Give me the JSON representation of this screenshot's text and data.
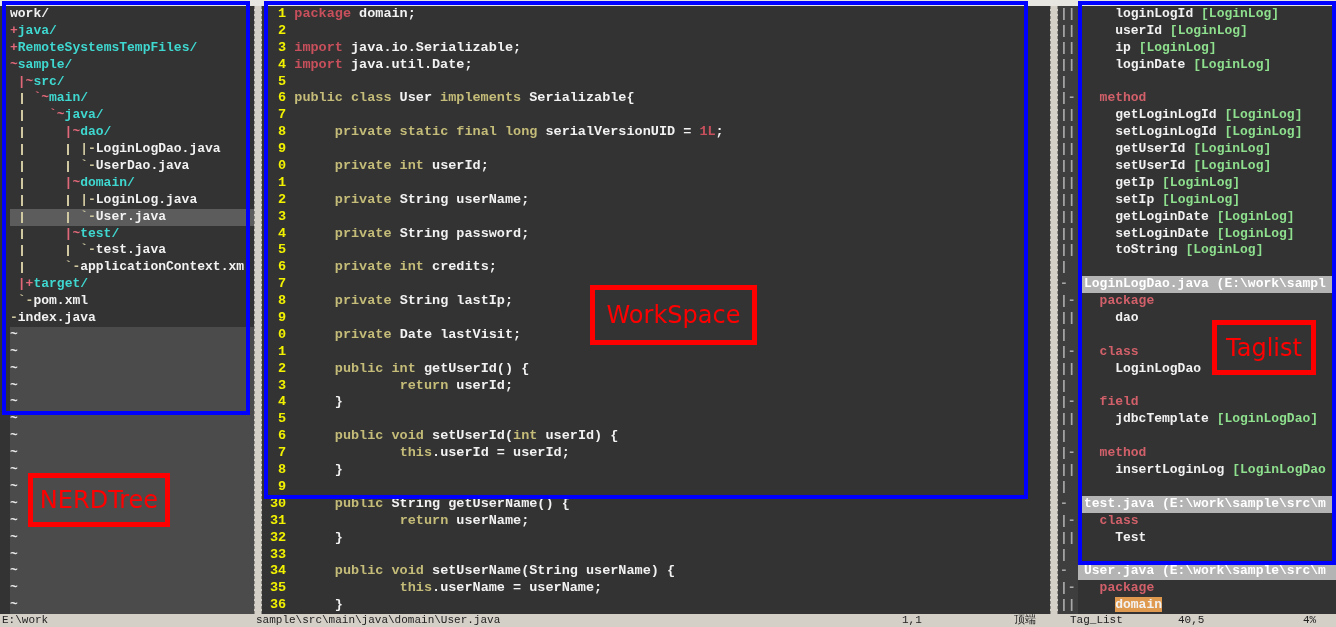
{
  "nerdtree": {
    "root": "work/",
    "nodes": [
      {
        "prefix": "+",
        "name": "java/",
        "kind": "dir",
        "selected": false
      },
      {
        "prefix": "+",
        "name": "RemoteSystemsTempFiles/",
        "kind": "dir",
        "selected": false
      },
      {
        "prefix": "~",
        "name": "sample/",
        "kind": "dir",
        "selected": false,
        "children": [
          {
            "prefix": "|~",
            "name": "src/",
            "kind": "dir",
            "selected": false,
            "children": [
              {
                "prefix": "`~",
                "name": "main/",
                "kind": "dir",
                "selected": false,
                "children": [
                  {
                    "prefix": "`~",
                    "name": "java/",
                    "kind": "dir",
                    "selected": false,
                    "children": [
                      {
                        "prefix": "|~",
                        "name": "dao/",
                        "kind": "dir",
                        "selected": false,
                        "children": [
                          {
                            "prefix": "|-",
                            "name": "LoginLogDao.java",
                            "kind": "file",
                            "selected": false
                          },
                          {
                            "prefix": "`-",
                            "name": "UserDao.java",
                            "kind": "file",
                            "selected": false
                          }
                        ]
                      },
                      {
                        "prefix": "|~",
                        "name": "domain/",
                        "kind": "dir",
                        "selected": false,
                        "children": [
                          {
                            "prefix": "|-",
                            "name": "LoginLog.java",
                            "kind": "file",
                            "selected": false
                          },
                          {
                            "prefix": "`-",
                            "name": "User.java",
                            "kind": "file",
                            "selected": true
                          }
                        ]
                      },
                      {
                        "prefix": "|~",
                        "name": "test/",
                        "kind": "dir",
                        "selected": false,
                        "children": [
                          {
                            "prefix": "`-",
                            "name": "test.java",
                            "kind": "file",
                            "selected": false
                          }
                        ]
                      },
                      {
                        "prefix": "`-",
                        "name": "applicationContext.xm",
                        "kind": "file",
                        "selected": false
                      }
                    ]
                  }
                ]
              }
            ]
          },
          {
            "prefix": "|+",
            "name": "target/",
            "kind": "dir",
            "selected": false
          },
          {
            "prefix": "`-",
            "name": "pom.xml",
            "kind": "file",
            "selected": false
          }
        ]
      },
      {
        "prefix": "-",
        "name": "index.java",
        "kind": "file",
        "selected": false
      }
    ],
    "tildes": [
      "~",
      "~",
      "~",
      "~",
      "~",
      "~",
      "~",
      "~",
      "~",
      "~",
      "~",
      "~",
      "~",
      "~",
      "~",
      "~",
      "~"
    ]
  },
  "editor": {
    "lines": [
      {
        "n": "1",
        "code": [
          {
            "text": "package",
            "kind": "r"
          },
          {
            "text": " domain;",
            "kind": "p"
          }
        ]
      },
      {
        "n": "2"
      },
      {
        "n": "3",
        "code": [
          {
            "text": "import",
            "kind": "r"
          },
          {
            "text": " java.io.Serializable;",
            "kind": "p"
          }
        ]
      },
      {
        "n": "4",
        "code": [
          {
            "text": "import",
            "kind": "r"
          },
          {
            "text": " java.util.Date;",
            "kind": "p"
          }
        ]
      },
      {
        "n": "5"
      },
      {
        "n": "6",
        "code": [
          {
            "text": "public class",
            "kind": "k"
          },
          {
            "text": " User ",
            "kind": "p"
          },
          {
            "text": "implements",
            "kind": "k"
          },
          {
            "text": " Serializable{",
            "kind": "p"
          }
        ]
      },
      {
        "n": "7"
      },
      {
        "n": "8",
        "code": [
          {
            "text": "\tprivate static final long",
            "kind": "k"
          },
          {
            "text": " serialVersionUID = ",
            "kind": "p"
          },
          {
            "text": "1L",
            "kind": "r"
          },
          {
            "text": ";",
            "kind": "p"
          }
        ]
      },
      {
        "n": "9"
      },
      {
        "n": "0",
        "code": [
          {
            "text": "\tprivate int",
            "kind": "k"
          },
          {
            "text": " userId;",
            "kind": "p"
          }
        ]
      },
      {
        "n": "1"
      },
      {
        "n": "2",
        "code": [
          {
            "text": "\tprivate",
            "kind": "k"
          },
          {
            "text": " String userName;",
            "kind": "p"
          }
        ]
      },
      {
        "n": "3"
      },
      {
        "n": "4",
        "code": [
          {
            "text": "\tprivate",
            "kind": "k"
          },
          {
            "text": " String password;",
            "kind": "p"
          }
        ]
      },
      {
        "n": "5"
      },
      {
        "n": "6",
        "code": [
          {
            "text": "\tprivate int",
            "kind": "k"
          },
          {
            "text": " credits;",
            "kind": "p"
          }
        ]
      },
      {
        "n": "7"
      },
      {
        "n": "8",
        "code": [
          {
            "text": "\tprivate",
            "kind": "k"
          },
          {
            "text": " String lastIp;",
            "kind": "p"
          }
        ]
      },
      {
        "n": "9"
      },
      {
        "n": "0",
        "code": [
          {
            "text": "\tprivate",
            "kind": "k"
          },
          {
            "text": " Date lastVisit;",
            "kind": "p"
          }
        ]
      },
      {
        "n": "1"
      },
      {
        "n": "2",
        "code": [
          {
            "text": "\tpublic int",
            "kind": "k"
          },
          {
            "text": " getUserId() {",
            "kind": "p"
          }
        ]
      },
      {
        "n": "3",
        "code": [
          {
            "text": "\t\treturn",
            "kind": "k"
          },
          {
            "text": " userId;",
            "kind": "p"
          }
        ]
      },
      {
        "n": "4",
        "code": [
          {
            "text": "\t}",
            "kind": "p"
          }
        ]
      },
      {
        "n": "5"
      },
      {
        "n": "6",
        "code": [
          {
            "text": "\tpublic void",
            "kind": "k"
          },
          {
            "text": " setUserId(",
            "kind": "p"
          },
          {
            "text": "int",
            "kind": "k"
          },
          {
            "text": " userId) {",
            "kind": "p"
          }
        ]
      },
      {
        "n": "7",
        "code": [
          {
            "text": "\t\tthis",
            "kind": "k"
          },
          {
            "text": ".userId = userId;",
            "kind": "p"
          }
        ]
      },
      {
        "n": "8",
        "code": [
          {
            "text": "\t}",
            "kind": "p"
          }
        ]
      },
      {
        "n": "9"
      },
      {
        "n": "30",
        "code": [
          {
            "text": "\tpublic",
            "kind": "k"
          },
          {
            "text": " String getUserName() {",
            "kind": "p"
          }
        ]
      },
      {
        "n": "31",
        "code": [
          {
            "text": "\t\treturn",
            "kind": "k"
          },
          {
            "text": " userName;",
            "kind": "p"
          }
        ]
      },
      {
        "n": "32",
        "code": [
          {
            "text": "\t}",
            "kind": "p"
          }
        ]
      },
      {
        "n": "33"
      },
      {
        "n": "34",
        "code": [
          {
            "text": "\tpublic void",
            "kind": "k"
          },
          {
            "text": " setUserName(String userName) {",
            "kind": "p"
          }
        ]
      },
      {
        "n": "35",
        "code": [
          {
            "text": "\t\tthis",
            "kind": "k"
          },
          {
            "text": ".userName = userName;",
            "kind": "p"
          }
        ]
      },
      {
        "n": "36",
        "code": [
          {
            "text": "\t}",
            "kind": "p"
          }
        ]
      }
    ]
  },
  "taglist": {
    "rows": [
      {
        "fold": "||",
        "kind": "tag",
        "name": "loginLogId",
        "scope": "[LoginLog]",
        "selected": false
      },
      {
        "fold": "||",
        "kind": "tag",
        "name": "userId",
        "scope": "[LoginLog]",
        "selected": false
      },
      {
        "fold": "||",
        "kind": "tag",
        "name": "ip",
        "scope": "[LoginLog]",
        "selected": false
      },
      {
        "fold": "||",
        "kind": "tag",
        "name": "loginDate",
        "scope": "[LoginLog]",
        "selected": false
      },
      {
        "fold": "|",
        "kind": "blank"
      },
      {
        "fold": "|-",
        "kind": "group",
        "name": "method"
      },
      {
        "fold": "||",
        "kind": "tag",
        "name": "getLoginLogId",
        "scope": "[LoginLog]",
        "selected": false
      },
      {
        "fold": "||",
        "kind": "tag",
        "name": "setLoginLogId",
        "scope": "[LoginLog]",
        "selected": false
      },
      {
        "fold": "||",
        "kind": "tag",
        "name": "getUserId",
        "scope": "[LoginLog]",
        "selected": false
      },
      {
        "fold": "||",
        "kind": "tag",
        "name": "setUserId",
        "scope": "[LoginLog]",
        "selected": false
      },
      {
        "fold": "||",
        "kind": "tag",
        "name": "getIp",
        "scope": "[LoginLog]",
        "selected": false
      },
      {
        "fold": "||",
        "kind": "tag",
        "name": "setIp",
        "scope": "[LoginLog]",
        "selected": false
      },
      {
        "fold": "||",
        "kind": "tag",
        "name": "getLoginDate",
        "scope": "[LoginLog]",
        "selected": false
      },
      {
        "fold": "||",
        "kind": "tag",
        "name": "setLoginDate",
        "scope": "[LoginLog]",
        "selected": false
      },
      {
        "fold": "||",
        "kind": "tag",
        "name": "toString",
        "scope": "[LoginLog]",
        "selected": false
      },
      {
        "fold": "|",
        "kind": "blank"
      },
      {
        "fold": "-",
        "kind": "file",
        "name": "LoginLogDao.java (E:\\work\\sampl"
      },
      {
        "fold": "|-",
        "kind": "group",
        "name": "package"
      },
      {
        "fold": "||",
        "kind": "tag",
        "name": "dao",
        "selected": false
      },
      {
        "fold": "|",
        "kind": "blank"
      },
      {
        "fold": "|-",
        "kind": "group",
        "name": "class"
      },
      {
        "fold": "||",
        "kind": "tag",
        "name": "LoginLogDao",
        "selected": false
      },
      {
        "fold": "|",
        "kind": "blank"
      },
      {
        "fold": "|-",
        "kind": "group",
        "name": "field"
      },
      {
        "fold": "||",
        "kind": "tag",
        "name": "jdbcTemplate",
        "scope": "[LoginLogDao]",
        "selected": false
      },
      {
        "fold": "|",
        "kind": "blank"
      },
      {
        "fold": "|-",
        "kind": "group",
        "name": "method"
      },
      {
        "fold": "||",
        "kind": "tag",
        "name": "insertLoginLog",
        "scope": "[LoginLogDao",
        "selected": false
      },
      {
        "fold": "|",
        "kind": "blank"
      },
      {
        "fold": "-",
        "kind": "file",
        "name": "test.java (E:\\work\\sample\\src\\m"
      },
      {
        "fold": "|-",
        "kind": "group",
        "name": "class"
      },
      {
        "fold": "||",
        "kind": "tag",
        "name": "Test",
        "selected": false
      },
      {
        "fold": "|",
        "kind": "blank"
      },
      {
        "fold": "-",
        "kind": "file",
        "name": "User.java (E:\\work\\sample\\src\\m"
      },
      {
        "fold": "|-",
        "kind": "group",
        "name": "package"
      },
      {
        "fold": "||",
        "kind": "tag",
        "name": "domain",
        "selected": true
      }
    ]
  },
  "status_line": [
    "E:\\work",
    "sample\\src\\main\\java\\domain\\User.java",
    "1,1",
    "顶端",
    "Tag_List",
    "40,5",
    "4%"
  ],
  "annotations": [
    {
      "label": "NERDTree"
    },
    {
      "label": "WorkSpace"
    },
    {
      "label": "Taglist"
    }
  ]
}
